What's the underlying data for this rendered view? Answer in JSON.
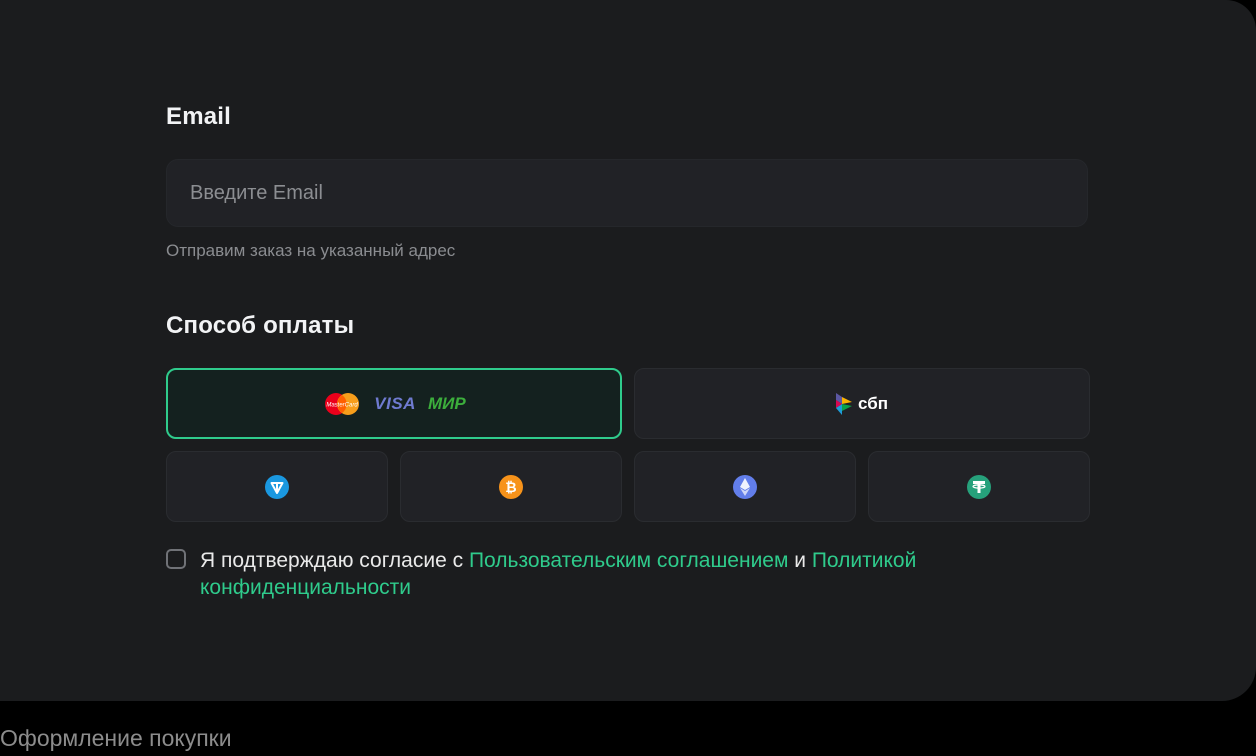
{
  "email": {
    "label": "Email",
    "placeholder": "Введите Email",
    "hint": "Отправим заказ на указанный адрес"
  },
  "payment": {
    "label": "Способ оплаты",
    "card_option": {
      "visa_label": "VISA",
      "mir_label": "МИР",
      "mastercard_label": "MasterCard",
      "selected": true
    },
    "sbp_option": {
      "label": "сбп"
    },
    "crypto_icons": [
      "ton-icon",
      "bitcoin-icon",
      "ethereum-icon",
      "tether-icon"
    ]
  },
  "consent": {
    "text_before": "Я подтверждаю согласие с ",
    "link_agreement": "Пользовательским соглашением",
    "text_and": " и ",
    "link_policy": "Политикой конфиденциальности"
  },
  "caption": "Оформление покупки",
  "colors": {
    "accent": "#2fcb8c",
    "panel_bg": "#1b1c1e",
    "field_bg": "#212226",
    "ton": "#1a98e0",
    "bitcoin": "#f7931a",
    "ethereum": "#627eea",
    "tether": "#26a17b",
    "visa": "#6f7bd0",
    "mir": "#3cae3c"
  }
}
